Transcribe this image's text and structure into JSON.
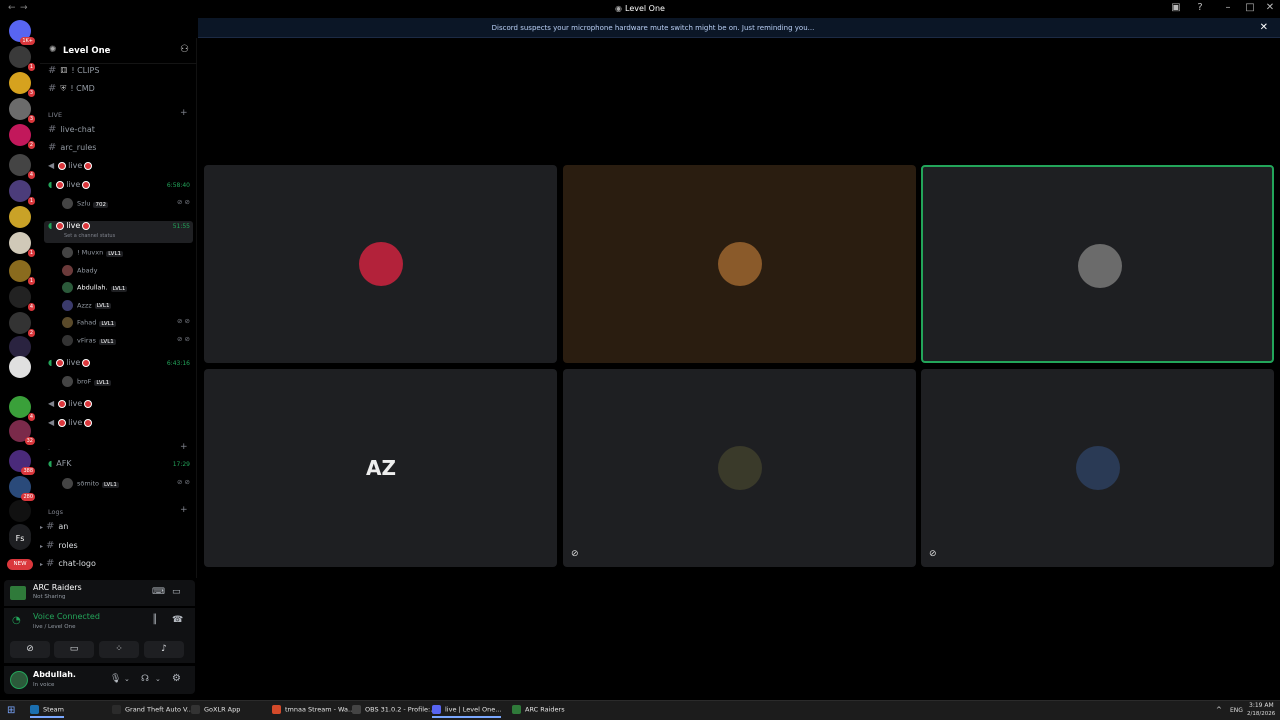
{
  "window": {
    "title": "Level One"
  },
  "notice": {
    "message": "Discord suspects your microphone hardware mute switch might be on. Just reminding you...",
    "close": "✕"
  },
  "rail": {
    "items": [
      {
        "badge": "1K+",
        "color": "#5865f2"
      },
      {
        "badge": "1",
        "color": "#3a3a3a"
      },
      {
        "badge": "3",
        "color": "#d6a21e"
      },
      {
        "badge": "3",
        "color": "#6b6b6b"
      },
      {
        "badge": "2",
        "color": "#c2185b"
      },
      {
        "badge": "4",
        "color": "#444"
      },
      {
        "badge": "1",
        "color": "#4b3c7a"
      },
      {
        "badge": "",
        "color": "#c9a227"
      },
      {
        "badge": "1",
        "color": "#d0c9b8"
      },
      {
        "badge": "1",
        "color": "#8a6b1e"
      },
      {
        "badge": "4",
        "color": "#222"
      },
      {
        "badge": "2",
        "color": "#333"
      },
      {
        "badge": "",
        "color": "#2a2340"
      },
      {
        "badge": "",
        "color": "#e0e0e0"
      },
      {
        "badge": "4",
        "color": "#3aa03a"
      },
      {
        "badge": "32",
        "color": "#7a2a4a"
      },
      {
        "badge": "388",
        "color": "#4a2a7a"
      },
      {
        "badge": "280",
        "color": "#2a4a7a"
      },
      {
        "badge": "",
        "color": "#111"
      },
      {
        "badge": "",
        "color": "#1e1f22"
      }
    ],
    "fs_label": "Fs",
    "new_label": "NEW"
  },
  "sidebar": {
    "server_name": "Level One",
    "channels_top": [
      {
        "name": "! CLIPS"
      },
      {
        "name": "! CMD"
      }
    ],
    "live_category": "LIVE",
    "text_channels": [
      "live-chat",
      "arc_rules"
    ],
    "voice": [
      {
        "name": "live",
        "time": "",
        "users": []
      },
      {
        "name": "live",
        "time": "6:58:40",
        "users": [
          {
            "name": "Szlu",
            "badge": "702"
          }
        ]
      },
      {
        "name": "live",
        "time": "51:55",
        "status": "Set a channel status",
        "users": [
          {
            "name": "! Muvxn",
            "badge": "LVL1"
          },
          {
            "name": "Abady",
            "badge": ""
          },
          {
            "name": "Abdullah.",
            "badge": "LVL1"
          },
          {
            "name": "Azzz",
            "badge": "LVL1"
          },
          {
            "name": "Fahad",
            "badge": "LVL1"
          },
          {
            "name": "vFiras",
            "badge": "LVL1"
          }
        ]
      },
      {
        "name": "live",
        "time": "6:43:16",
        "users": [
          {
            "name": "broF",
            "badge": "LVL1"
          }
        ]
      },
      {
        "name": "live",
        "time": "",
        "users": []
      },
      {
        "name": "live",
        "time": "",
        "users": []
      }
    ],
    "afk": {
      "name": "AFK",
      "time": "17:29",
      "user": "sōmito",
      "badge": "LVL1"
    },
    "logs_category": "Logs",
    "logs_channels": [
      "an",
      "roles",
      "chat-logo"
    ]
  },
  "activity": {
    "game": "ARC Raiders",
    "status": "Not Sharing"
  },
  "voice_panel": {
    "title": "Voice Connected",
    "location": "live / Level One"
  },
  "userbar": {
    "name": "Abdullah.",
    "status": "In voice"
  },
  "stage": {
    "tiles": [
      {
        "bg": "#1e1f22",
        "avatar_color": "#b3223a",
        "speaking": false,
        "muted": false
      },
      {
        "bg": "#2a1d10",
        "avatar_color": "#8a5a2a",
        "speaking": false,
        "muted": false
      },
      {
        "bg": "#1e1f22",
        "avatar_color": "#6b6b6b",
        "speaking": true,
        "muted": false
      },
      {
        "bg": "#1e1f22",
        "avatar_text": "AZ",
        "speaking": false,
        "muted": false
      },
      {
        "bg": "#1e1f22",
        "avatar_color": "#3a3a2a",
        "speaking": false,
        "muted": true
      },
      {
        "bg": "#1e1f22",
        "avatar_color": "#2a3a55",
        "speaking": false,
        "muted": true
      }
    ]
  },
  "taskbar": {
    "items": [
      {
        "label": "Steam",
        "color": "#1b6fb0",
        "active": true
      },
      {
        "label": "Grand Theft Auto V...",
        "color": "#2b2b2b",
        "active": false
      },
      {
        "label": "GoXLR App",
        "color": "#333",
        "active": false
      },
      {
        "label": "tmnaa Stream - Wa...",
        "color": "#d34a2a",
        "active": false
      },
      {
        "label": "OBS 31.0.2 - Profile:...",
        "color": "#444",
        "active": false
      },
      {
        "label": "live | Level One...",
        "color": "#5865f2",
        "active": true
      },
      {
        "label": "ARC Raiders",
        "color": "#2f7a3a",
        "active": false
      }
    ],
    "lang": "ENG",
    "time": "3:19 AM",
    "date": "2/18/2026"
  }
}
